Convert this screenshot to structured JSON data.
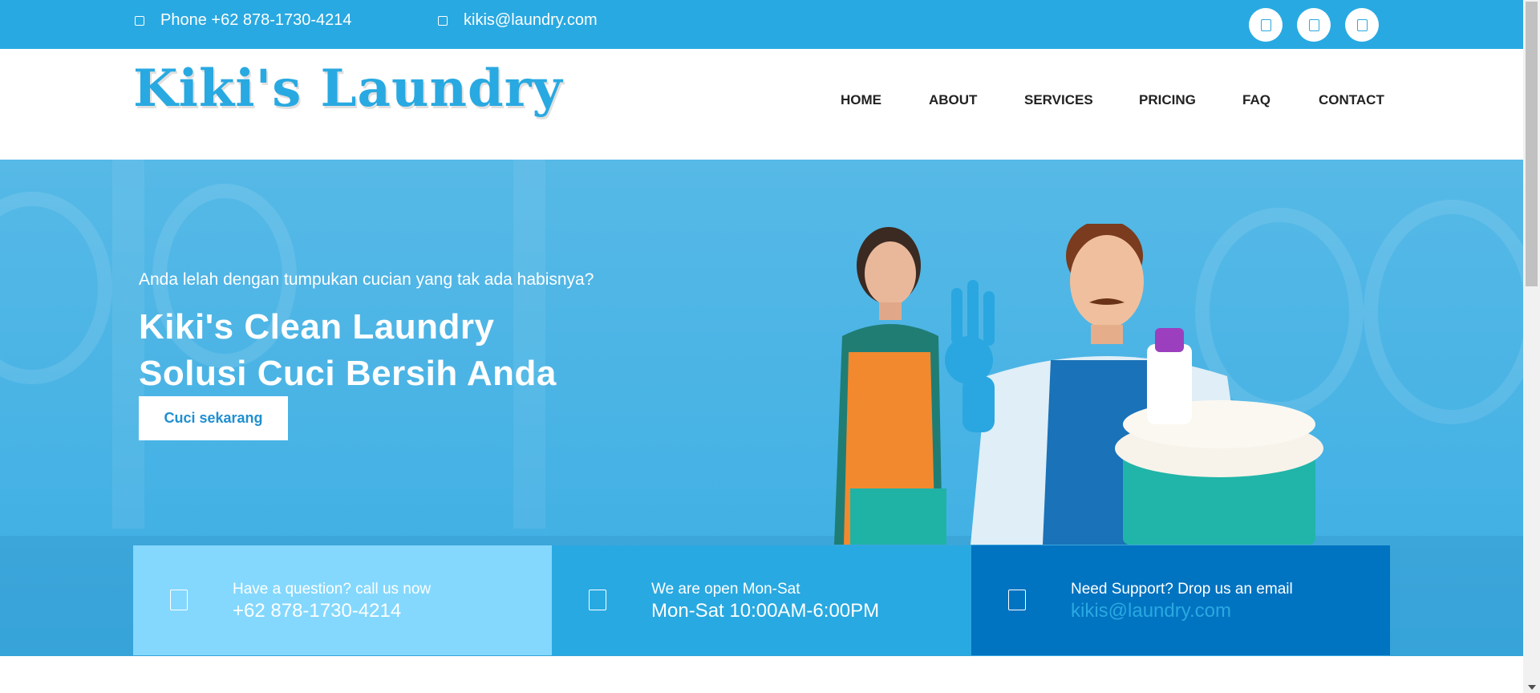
{
  "topbar": {
    "phone": "Phone +62 878-1730-4214",
    "email": "kikis@laundry.com",
    "social_icons": [
      "facebook-icon",
      "twitter-icon",
      "instagram-icon"
    ]
  },
  "header": {
    "logo": "Kiki's Laundry",
    "nav": [
      "HOME",
      "ABOUT",
      "SERVICES",
      "PRICING",
      "FAQ",
      "CONTACT"
    ]
  },
  "hero": {
    "subtitle": "Anda lelah dengan tumpukan cucian yang tak ada habisnya?",
    "title_line1": "Kiki's Clean Laundry",
    "title_line2": "Solusi Cuci Bersih Anda",
    "cta": "Cuci sekarang"
  },
  "info": [
    {
      "label": "Have a question? call us now",
      "value": "+62 878-1730-4214",
      "icon": "phone-icon"
    },
    {
      "label": "We are open Mon-Sat",
      "value": "Mon-Sat 10:00AM-6:00PM",
      "icon": "clock-icon"
    },
    {
      "label": "Need Support? Drop us an email",
      "value": "kikis@laundry.com",
      "icon": "envelope-icon"
    }
  ],
  "colors": {
    "brand": "#29a9e1",
    "light_blue": "#84d8fd",
    "dark_blue": "#0073c1"
  }
}
